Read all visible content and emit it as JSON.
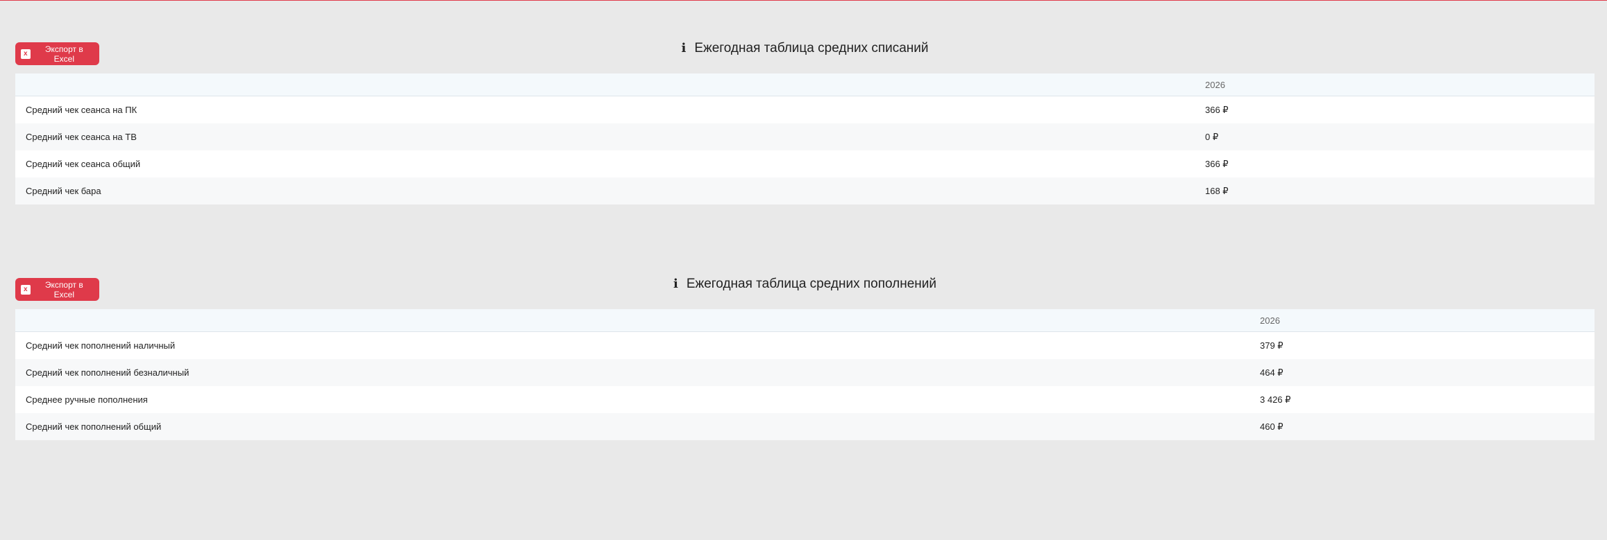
{
  "colors": {
    "accent": "#df3a4a",
    "background": "#e9e9e9"
  },
  "writeoffs": {
    "export_label": "Экспорт в Excel",
    "title": "Ежегодная таблица средних списаний",
    "year": "2026",
    "rows": [
      {
        "label": "Средний чек сеанса на ПК",
        "value": "366 ₽"
      },
      {
        "label": "Средний чек сеанса на ТВ",
        "value": "0 ₽"
      },
      {
        "label": "Средний чек сеанса общий",
        "value": "366 ₽"
      },
      {
        "label": "Средний чек бара",
        "value": "168 ₽"
      }
    ]
  },
  "topups": {
    "export_label": "Экспорт в Excel",
    "title": "Ежегодная таблица средних пополнений",
    "year": "2026",
    "rows": [
      {
        "label": "Средний чек пополнений наличный",
        "value": "379 ₽"
      },
      {
        "label": "Средний чек пополнений безналичный",
        "value": "464 ₽"
      },
      {
        "label": "Среднее ручные пополнения",
        "value": "3 426 ₽"
      },
      {
        "label": "Средний чек пополнений общий",
        "value": "460 ₽"
      }
    ]
  }
}
